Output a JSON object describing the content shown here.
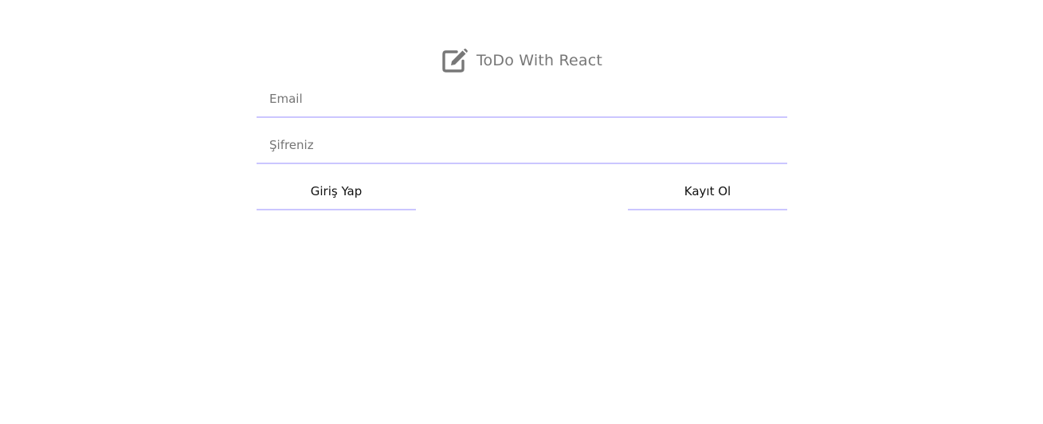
{
  "header": {
    "title": "ToDo With React",
    "icon": "edit-icon",
    "icon_color": "#777777"
  },
  "form": {
    "email_placeholder": "Email",
    "email_value": "",
    "password_placeholder": "Şifreniz",
    "password_value": "",
    "login_label": "Giriş Yap",
    "register_label": "Kayıt Ol",
    "accent_color": "#cbc6ff"
  }
}
